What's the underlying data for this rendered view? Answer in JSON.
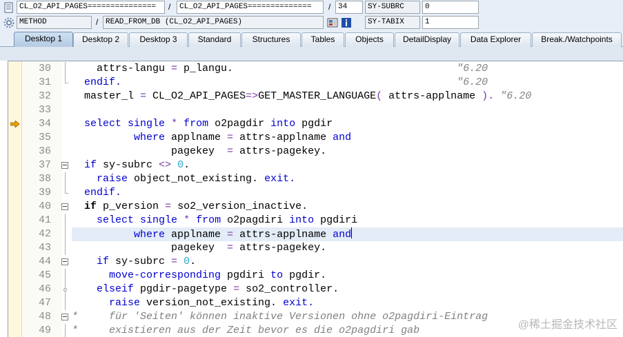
{
  "header": {
    "row1": {
      "program": "CL_O2_API_PAGES===============",
      "include": "CL_O2_API_PAGES==============",
      "line": "34",
      "sysvar1_name": "SY-SUBRC",
      "sysvar1_value": "0"
    },
    "row2": {
      "type": "METHOD",
      "event": "READ_FROM_DB (CL_O2_API_PAGES)",
      "sysvar2_name": "SY-TABIX",
      "sysvar2_value": "1"
    }
  },
  "tabs": [
    "Desktop 1",
    "Desktop 2",
    "Desktop 3",
    "Standard",
    "Structures",
    "Tables",
    "Objects",
    "DetailDisplay",
    "Data Explorer",
    "Break./Watchpoints"
  ],
  "code_lines": [
    {
      "no": "30",
      "text": "    attrs-langu = p_langu.                                    \"6.20"
    },
    {
      "no": "31",
      "text": "  endif.                                                      \"6.20"
    },
    {
      "no": "32",
      "text": "  master_l = CL_O2_API_PAGES=>GET_MASTER_LANGUAGE( attrs-applname ). \"6.20"
    },
    {
      "no": "33",
      "text": ""
    },
    {
      "no": "34",
      "text": "  select single * from o2pagdir into pgdir"
    },
    {
      "no": "35",
      "text": "          where applname = attrs-applname and"
    },
    {
      "no": "36",
      "text": "                pagekey  = attrs-pagekey."
    },
    {
      "no": "37",
      "text": "  if sy-subrc <> 0."
    },
    {
      "no": "38",
      "text": "    raise object_not_existing. exit."
    },
    {
      "no": "39",
      "text": "  endif."
    },
    {
      "no": "40",
      "text": "  if p_version = so2_version_inactive."
    },
    {
      "no": "41",
      "text": "    select single * from o2pagdiri into pgdiri"
    },
    {
      "no": "42",
      "text": "          where applname = attrs-applname and"
    },
    {
      "no": "43",
      "text": "                pagekey  = attrs-pagekey."
    },
    {
      "no": "44",
      "text": "    if sy-subrc = 0."
    },
    {
      "no": "45",
      "text": "      move-corresponding pgdiri to pgdir."
    },
    {
      "no": "46",
      "text": "    elseif pgdir-pagetype = so2_controller."
    },
    {
      "no": "47",
      "text": "      raise version_not_existing. exit."
    },
    {
      "no": "48",
      "text": "*     für 'Seiten' können inaktive Versionen ohne o2pagdiri-Eintrag"
    },
    {
      "no": "49",
      "text": "*     existieren aus der Zeit bevor es die o2pagdiri gab"
    }
  ],
  "watermark": "@稀土掘金技术社区",
  "colors": {
    "keyword": "#0000d0",
    "number": "#2fa5c9",
    "comment": "#808080",
    "active_tab": "#b4cbe3"
  }
}
